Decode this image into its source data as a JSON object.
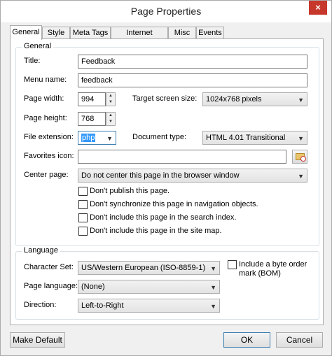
{
  "window": {
    "title": "Page Properties",
    "close_glyph": "×"
  },
  "tabs": [
    {
      "label": "General",
      "active": true
    },
    {
      "label": "Style"
    },
    {
      "label": "Meta Tags"
    },
    {
      "label": "Internet Explorer"
    },
    {
      "label": "Misc"
    },
    {
      "label": "Events"
    }
  ],
  "general": {
    "group_label": "General",
    "title_label": "Title:",
    "title_value": "Feedback",
    "menu_name_label": "Menu name:",
    "menu_name_value": "feedback",
    "page_width_label": "Page width:",
    "page_width_value": "994",
    "page_height_label": "Page height:",
    "page_height_value": "768",
    "target_screen_label": "Target screen size:",
    "target_screen_value": "1024x768 pixels",
    "file_ext_label": "File extension:",
    "file_ext_value": "php",
    "doc_type_label": "Document type:",
    "doc_type_value": "HTML 4.01 Transitional",
    "favicon_label": "Favorites icon:",
    "favicon_value": "",
    "center_label": "Center page:",
    "center_value": "Do not center this page in the browser window",
    "checkboxes": [
      "Don't publish this page.",
      "Don't synchronize this page in navigation objects.",
      "Don't include this page in the search index.",
      "Don't include this page in the site map."
    ]
  },
  "language": {
    "group_label": "Language",
    "charset_label": "Character Set:",
    "charset_value": "US/Western European (ISO-8859-1)",
    "bom_label_line1": "Include a byte order",
    "bom_label_line2": "mark (BOM)",
    "page_lang_label": "Page language:",
    "page_lang_value": "(None)",
    "direction_label": "Direction:",
    "direction_value": "Left-to-Right"
  },
  "buttons": {
    "make_default": "Make Default",
    "ok": "OK",
    "cancel": "Cancel"
  },
  "icons": {
    "dropdown": "chevron-down-icon",
    "spin": "spin-arrows-icon",
    "browse": "folder-icon",
    "close": "close-icon"
  }
}
